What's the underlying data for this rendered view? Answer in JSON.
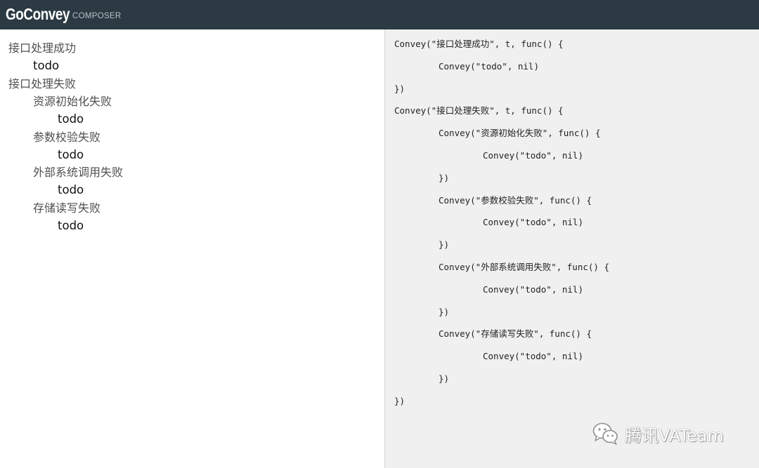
{
  "header": {
    "brand": "GoConvey",
    "subtitle": "COMPOSER"
  },
  "outline": [
    {
      "text": "接口处理成功",
      "kind": "desc",
      "level": 0
    },
    {
      "text": "todo",
      "kind": "todo",
      "level": 1
    },
    {
      "text": "接口处理失败",
      "kind": "desc",
      "level": 0
    },
    {
      "text": "资源初始化失败",
      "kind": "desc",
      "level": 1
    },
    {
      "text": "todo",
      "kind": "todo",
      "level": 2
    },
    {
      "text": "参数校验失败",
      "kind": "desc",
      "level": 1
    },
    {
      "text": "todo",
      "kind": "todo",
      "level": 2
    },
    {
      "text": "外部系统调用失败",
      "kind": "desc",
      "level": 1
    },
    {
      "text": "todo",
      "kind": "todo",
      "level": 2
    },
    {
      "text": "存储读写失败",
      "kind": "desc",
      "level": 1
    },
    {
      "text": "todo",
      "kind": "todo",
      "level": 2
    }
  ],
  "code": [
    {
      "text": "Convey(\"接口处理成功\", t, func() {",
      "indent": 0
    },
    {
      "text": "Convey(\"todo\", nil)",
      "indent": 1
    },
    {
      "text": "})",
      "indent": 0
    },
    {
      "text": "Convey(\"接口处理失败\", t, func() {",
      "indent": 0
    },
    {
      "text": "Convey(\"资源初始化失败\", func() {",
      "indent": 1
    },
    {
      "text": "Convey(\"todo\", nil)",
      "indent": 2
    },
    {
      "text": "})",
      "indent": 1
    },
    {
      "text": "Convey(\"参数校验失败\", func() {",
      "indent": 1
    },
    {
      "text": "Convey(\"todo\", nil)",
      "indent": 2
    },
    {
      "text": "})",
      "indent": 1
    },
    {
      "text": "Convey(\"外部系统调用失败\", func() {",
      "indent": 1
    },
    {
      "text": "Convey(\"todo\", nil)",
      "indent": 2
    },
    {
      "text": "})",
      "indent": 1
    },
    {
      "text": "Convey(\"存储读写失败\", func() {",
      "indent": 1
    },
    {
      "text": "Convey(\"todo\", nil)",
      "indent": 2
    },
    {
      "text": "})",
      "indent": 1
    },
    {
      "text": "})",
      "indent": 0
    }
  ],
  "watermark": {
    "text": "腾讯VATeam",
    "icon": "wechat-icon"
  },
  "colors": {
    "header_bg": "#2b3a43",
    "code_bg": "#f0f0f0"
  }
}
